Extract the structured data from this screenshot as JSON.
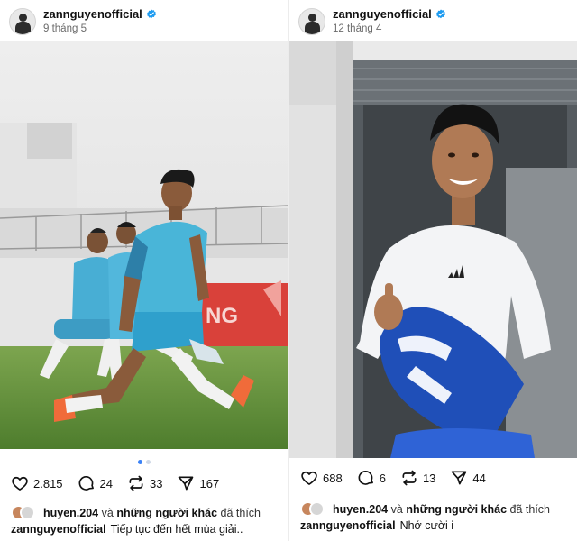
{
  "posts": [
    {
      "username": "zannguyenofficial",
      "date": "9 tháng 5",
      "likes": "2.815",
      "comments": "24",
      "reposts": "33",
      "shares": "167",
      "liked_by_user": "huyen.204",
      "liked_by_and": "và",
      "liked_by_others": "những người khác",
      "liked_by_suffix": "đã thích",
      "caption": "Tiếp tục đến hết mùa giải..",
      "carousel_pages": 2,
      "carousel_active": 1
    },
    {
      "username": "zannguyenofficial",
      "date": "12 tháng 4",
      "likes": "688",
      "comments": "6",
      "reposts": "13",
      "shares": "44",
      "liked_by_user": "huyen.204",
      "liked_by_and": "và",
      "liked_by_others": "những người khác",
      "liked_by_suffix": "đã thích",
      "caption": "Nhớ cười i"
    }
  ],
  "icons": {
    "verified": "verified-badge-icon",
    "like": "heart-icon",
    "comment": "comment-bubble-icon",
    "repost": "repost-icon",
    "share": "send-icon"
  },
  "colors": {
    "verified_blue": "#1d9bf0",
    "carousel_active": "#3b82f6",
    "pitch_green": "#5f8f3a",
    "kit_cyan": "#49b5d8",
    "banner_red": "#d9413a",
    "jersey_blue": "#1f4fb8"
  }
}
